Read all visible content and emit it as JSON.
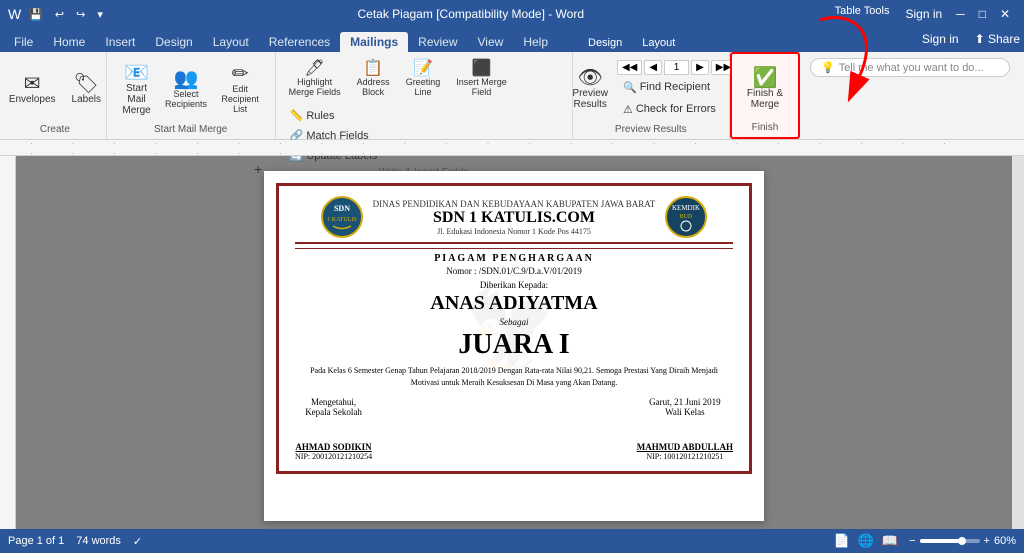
{
  "titlebar": {
    "title": "Cetak Piagam [Compatibility Mode] - Word",
    "table_tools": "Table Tools",
    "sign_in": "Sign in",
    "minimize": "─",
    "restore": "□",
    "close": "✕"
  },
  "qat": {
    "save": "💾",
    "undo": "↩",
    "redo": "↪",
    "dropdown": "▾"
  },
  "tabs": {
    "file": "File",
    "home": "Home",
    "insert": "Insert",
    "design": "Design",
    "layout": "Layout",
    "references": "References",
    "mailings": "Mailings",
    "review": "Review",
    "view": "View",
    "help": "Help",
    "table_design": "Design",
    "table_layout": "Layout"
  },
  "ribbon": {
    "create_group": "Create",
    "start_mail_merge_group": "Start Mail Merge",
    "write_insert_group": "Write & Insert Fields",
    "preview_group": "Preview Results",
    "finish_group": "Finish",
    "envelopes_label": "Envelopes",
    "labels_label": "Labels",
    "start_mail_merge_label": "Start Mail\nMerge",
    "select_recipients_label": "Select\nRecipients",
    "edit_recipient_list_label": "Edit\nRecipient List",
    "highlight_merge_fields_label": "Highlight\nMerge Fields",
    "address_block_label": "Address\nBlock",
    "greeting_line_label": "Greeting\nLine",
    "insert_merge_field_label": "Insert Merge\nField",
    "rules_label": "Rules",
    "match_fields_label": "Match Fields",
    "update_labels_label": "Update Labels",
    "preview_results_label": "Preview\nResults",
    "find_recipient_label": "Find Recipient",
    "check_errors_label": "Check for Errors",
    "finish_merge_label": "Finish &\nMerge",
    "finish_label": "Finish",
    "nav_prev": "◀",
    "nav_next": "▶",
    "nav_first": "◀◀",
    "nav_last": "▶▶",
    "nav_current": "1"
  },
  "tell_me": {
    "placeholder": "Tell me what you want to do..."
  },
  "certificate": {
    "gov_text": "DINAS PENDIDIKAN DAN KEBUDAYAAN KABUPATEN JAWA BARAT",
    "school_name": "SDN 1 KATULIS.COM",
    "address": "Jl. Edukasi Indonesia Nomor 1 Kode Pos 44175",
    "title": "PIAGAM PENGHARGAAN",
    "nomor_label": "Nomor  :  /SDN.01/C.9/D.a.V/01/2019",
    "diberikan_label": "Diberikan Kepada:",
    "recipient_name": "ANAS ADIYATMA",
    "sebagai_label": "Sebagai",
    "award": "JUARA I",
    "description": "Pada Kelas 6 Semester Genap Tahun Pelajaran 2018/2019 Dengan Rata-rata Nilai 90,21.\nSemoga Prestasi Yang Diraih Menjadi Motivasi untuk Meraih Kesuksesan\nDi Masa yang Akan Datang.",
    "mengetahui_label": "Mengetahui,",
    "date_label": "Garut, 21 Juni 2019",
    "kepala_sekolah_label": "Kepala Sekolah",
    "wali_kelas_label": "Wali Kelas",
    "principal_name": "AHMAD SODIKIN",
    "principal_nip": "NIP: 200120121210254",
    "teacher_name": "MAHMUD ABDULLAH",
    "teacher_nip": "NIP: 100120121210251"
  },
  "status": {
    "page_info": "Page 1 of 1",
    "word_count": "74 words",
    "zoom": "60%"
  }
}
